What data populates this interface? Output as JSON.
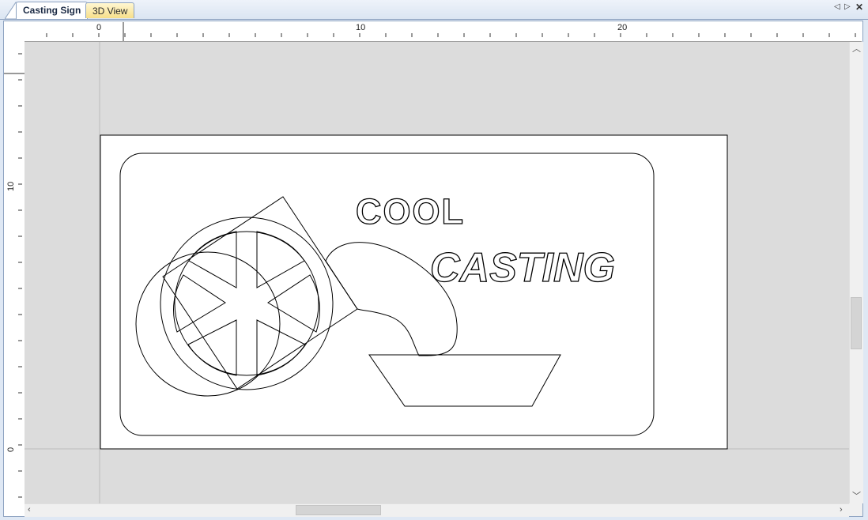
{
  "tabs": [
    {
      "label": "Casting Sign",
      "active": true
    },
    {
      "label": "3D View",
      "active": false
    }
  ],
  "tab_controls": {
    "left_icon": "triangle-left-icon",
    "right_icon": "triangle-right-icon",
    "close_icon": "close-icon",
    "close_glyph": "✕"
  },
  "ruler_top": {
    "labels": [
      "0",
      "10",
      "20"
    ]
  },
  "ruler_left": {
    "labels": [
      "10",
      "0"
    ]
  },
  "sign": {
    "line1": "COOL",
    "line2": "CASTING"
  },
  "colors": {
    "canvas": "#dcdcdc",
    "sheet": "#ffffff",
    "outline": "#000000",
    "tab_inactive": "#f7df8a"
  }
}
